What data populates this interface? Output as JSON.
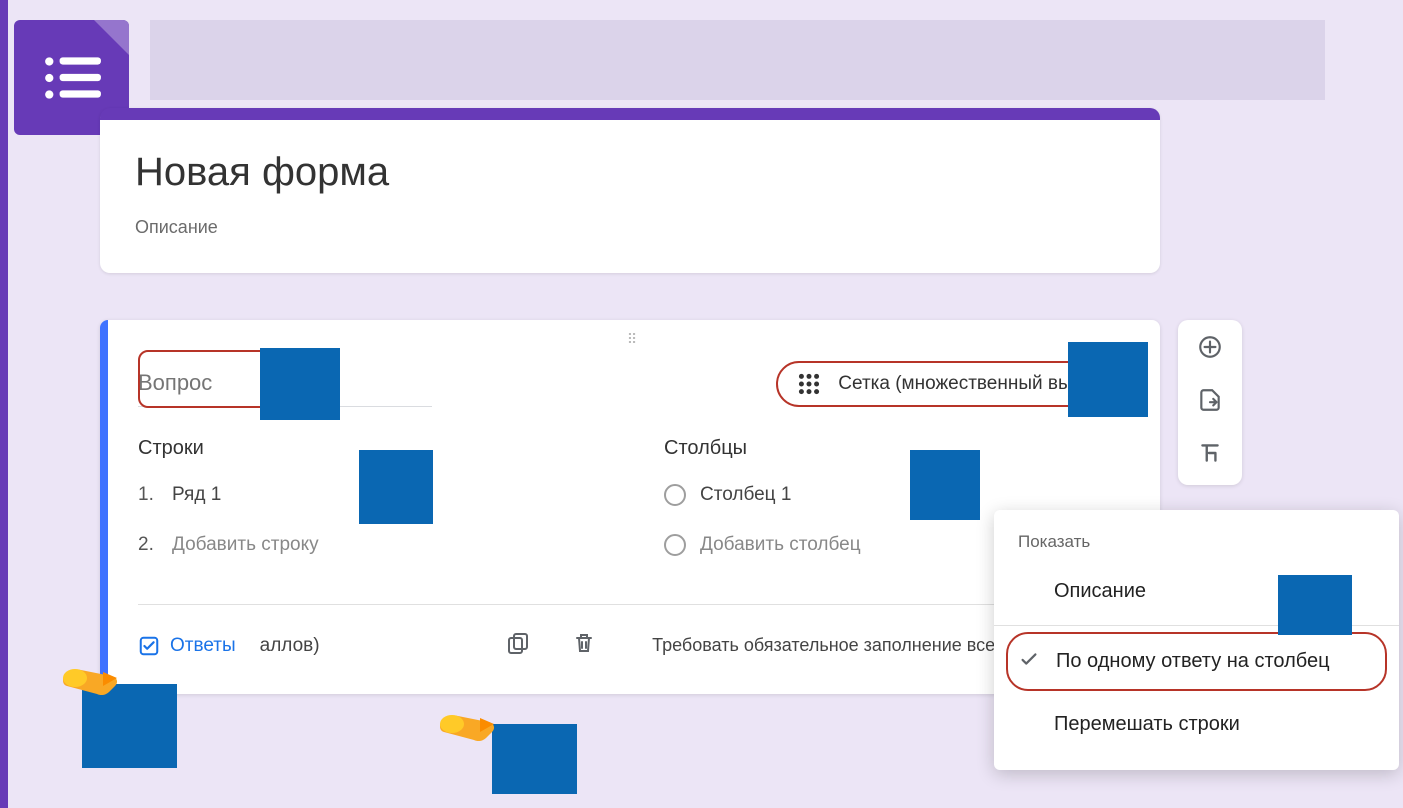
{
  "form": {
    "title": "Новая форма",
    "description": "Описание"
  },
  "question": {
    "placeholder": "Вопрос",
    "type_label": "Сетка (множественный выбор)",
    "rows_title": "Строки",
    "cols_title": "Столбцы",
    "row1": "Ряд 1",
    "add_row": "Добавить строку",
    "col1": "Столбец 1",
    "add_col": "Добавить столбец",
    "answers": "Ответы",
    "points": "аллов)",
    "require_label": "Требовать обязательное заполнение всех стро"
  },
  "menu": {
    "header": "Показать",
    "desc": "Описание",
    "one_per_col": "По одному ответу на столбец",
    "shuffle": "Перемешать строки"
  },
  "row_nums": {
    "one": "1.",
    "two": "2."
  }
}
